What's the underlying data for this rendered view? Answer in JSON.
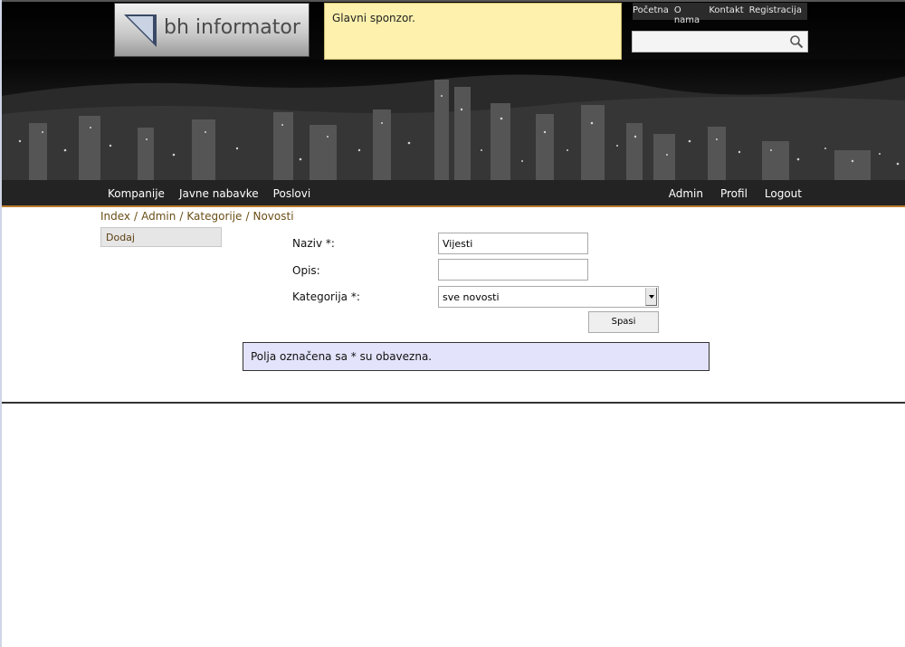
{
  "header": {
    "logo_text": "bh informator",
    "sponsor_text": "Glavni sponzor.",
    "top_links": [
      "Početna",
      "O nama",
      "Kontakt",
      "Registracija"
    ],
    "search": {
      "placeholder": "",
      "value": ""
    }
  },
  "nav": {
    "left": [
      "Kompanije",
      "Javne nabavke",
      "Poslovi"
    ],
    "right": [
      "Admin",
      "Profil",
      "Logout"
    ]
  },
  "breadcrumb": {
    "items": [
      "Index",
      "Admin",
      "Kategorije",
      "Novosti"
    ],
    "separator": "/"
  },
  "sidebar": {
    "add_label": "Dodaj"
  },
  "form": {
    "naziv_label": "Naziv *:",
    "naziv_value": "Vijesti",
    "opis_label": "Opis:",
    "opis_value": "",
    "kategorija_label": "Kategorija *:",
    "kategorija_value": "sve novosti",
    "submit_label": "Spasi"
  },
  "notice": "Polja označena sa * su obavezna.",
  "colors": {
    "nav_bg": "#232323",
    "nav_accent": "#b97c2d",
    "sponsor_bg": "#fdf1ad",
    "notice_bg": "#e3e3fb",
    "link_brown": "#6b4e16"
  }
}
